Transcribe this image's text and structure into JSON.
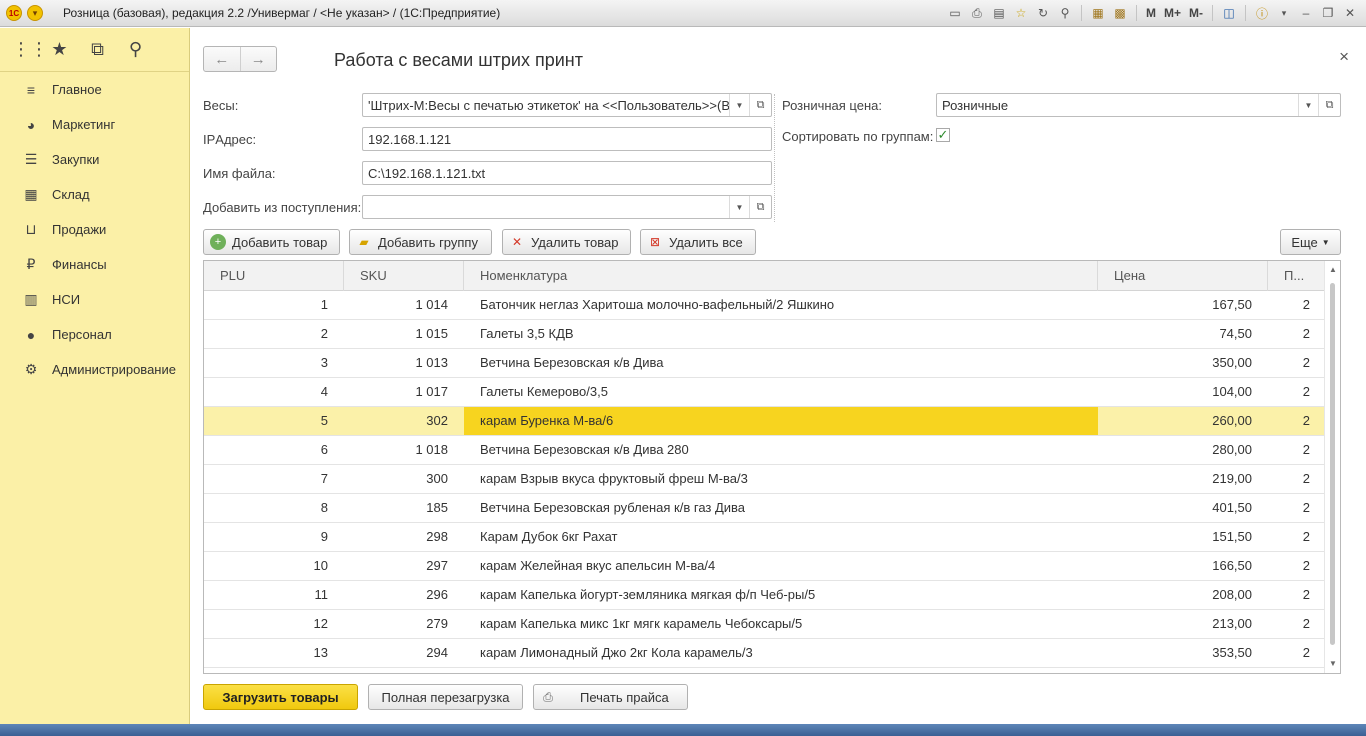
{
  "window": {
    "title": "Розница (базовая), редакция 2.2 /Универмаг / <Не указан> /  (1С:Предприятие)"
  },
  "titlebar_tools": {
    "m": "M",
    "m_plus": "M+",
    "m_minus": "M-"
  },
  "sidebar": {
    "items": [
      {
        "label": "Главное",
        "icon": "menu-lines-icon"
      },
      {
        "label": "Маркетинг",
        "icon": "pie-chart-icon"
      },
      {
        "label": "Закупки",
        "icon": "list-icon"
      },
      {
        "label": "Склад",
        "icon": "grid-icon"
      },
      {
        "label": "Продажи",
        "icon": "basket-icon"
      },
      {
        "label": "Финансы",
        "icon": "ruble-coin-icon"
      },
      {
        "label": "НСИ",
        "icon": "book-icon"
      },
      {
        "label": "Персонал",
        "icon": "person-icon"
      },
      {
        "label": "Администрирование",
        "icon": "gear-icon"
      }
    ]
  },
  "form": {
    "title": "Работа с весами штрих принт",
    "fields": {
      "scales_label": "Весы:",
      "scales_value": "'Штрих-М:Весы с печатью этикеток' на <<Пользователь>>(В",
      "ip_label": "IPАдрес:",
      "ip_value": "192.168.1.121",
      "file_label": "Имя файла:",
      "file_value": "C:\\192.168.1.121.txt",
      "add_from_label": "Добавить из поступления:",
      "add_from_value": "",
      "price_label": "Розничная цена:",
      "price_value": "Розничные",
      "sort_label": "Сортировать по группам:",
      "sort_checked": true
    },
    "toolbar": {
      "add_item": "Добавить товар",
      "add_group": "Добавить группу",
      "delete_item": "Удалить товар",
      "delete_all": "Удалить все",
      "more": "Еще"
    },
    "table": {
      "columns": [
        "PLU",
        "SKU",
        "Номенклатура",
        "Цена",
        "П..."
      ],
      "selected_row": 4,
      "rows": [
        {
          "plu": "1",
          "sku": "1 014",
          "name": "Батончик неглаз Харитоша молочно-вафельный/2 Яшкино",
          "price": "167,50",
          "p": "2"
        },
        {
          "plu": "2",
          "sku": "1 015",
          "name": "Галеты 3,5 КДВ",
          "price": "74,50",
          "p": "2"
        },
        {
          "plu": "3",
          "sku": "1 013",
          "name": "Ветчина Березовская к/в Дива",
          "price": "350,00",
          "p": "2"
        },
        {
          "plu": "4",
          "sku": "1 017",
          "name": "Галеты Кемерово/3,5",
          "price": "104,00",
          "p": "2"
        },
        {
          "plu": "5",
          "sku": "302",
          "name": "карам Буренка М-ва/6",
          "price": "260,00",
          "p": "2"
        },
        {
          "plu": "6",
          "sku": "1 018",
          "name": "Ветчина Березовская к/в Дива 280",
          "price": "280,00",
          "p": "2"
        },
        {
          "plu": "7",
          "sku": "300",
          "name": "карам Взрыв вкуса фруктовый фреш М-ва/3",
          "price": "219,00",
          "p": "2"
        },
        {
          "plu": "8",
          "sku": "185",
          "name": "Ветчина Березовская рубленая к/в газ Дива",
          "price": "401,50",
          "p": "2"
        },
        {
          "plu": "9",
          "sku": "298",
          "name": "Карам Дубок 6кг Рахат",
          "price": "151,50",
          "p": "2"
        },
        {
          "plu": "10",
          "sku": "297",
          "name": "карам Желейная  вкус апельсин М-ва/4",
          "price": "166,50",
          "p": "2"
        },
        {
          "plu": "11",
          "sku": "296",
          "name": "карам Капелька йогурт-земляника мягкая ф/п Чеб-ры/5",
          "price": "208,00",
          "p": "2"
        },
        {
          "plu": "12",
          "sku": "279",
          "name": "карам Капелька микс 1кг мягк карамель Чебоксары/5",
          "price": "213,00",
          "p": "2"
        },
        {
          "plu": "13",
          "sku": "294",
          "name": "карам Лимонадный Джо 2кг Кола карамель/3",
          "price": "353,50",
          "p": "2"
        }
      ]
    },
    "footer": {
      "load": "Загрузить товары",
      "reload": "Полная перезагрузка",
      "print": "Печать прайса"
    }
  },
  "colors": {
    "sidebar_bg": "#fbf0a7",
    "primary_button": "#f0c90e",
    "selected_row": "#fbf1a9",
    "selected_cell": "#f7d41f"
  }
}
